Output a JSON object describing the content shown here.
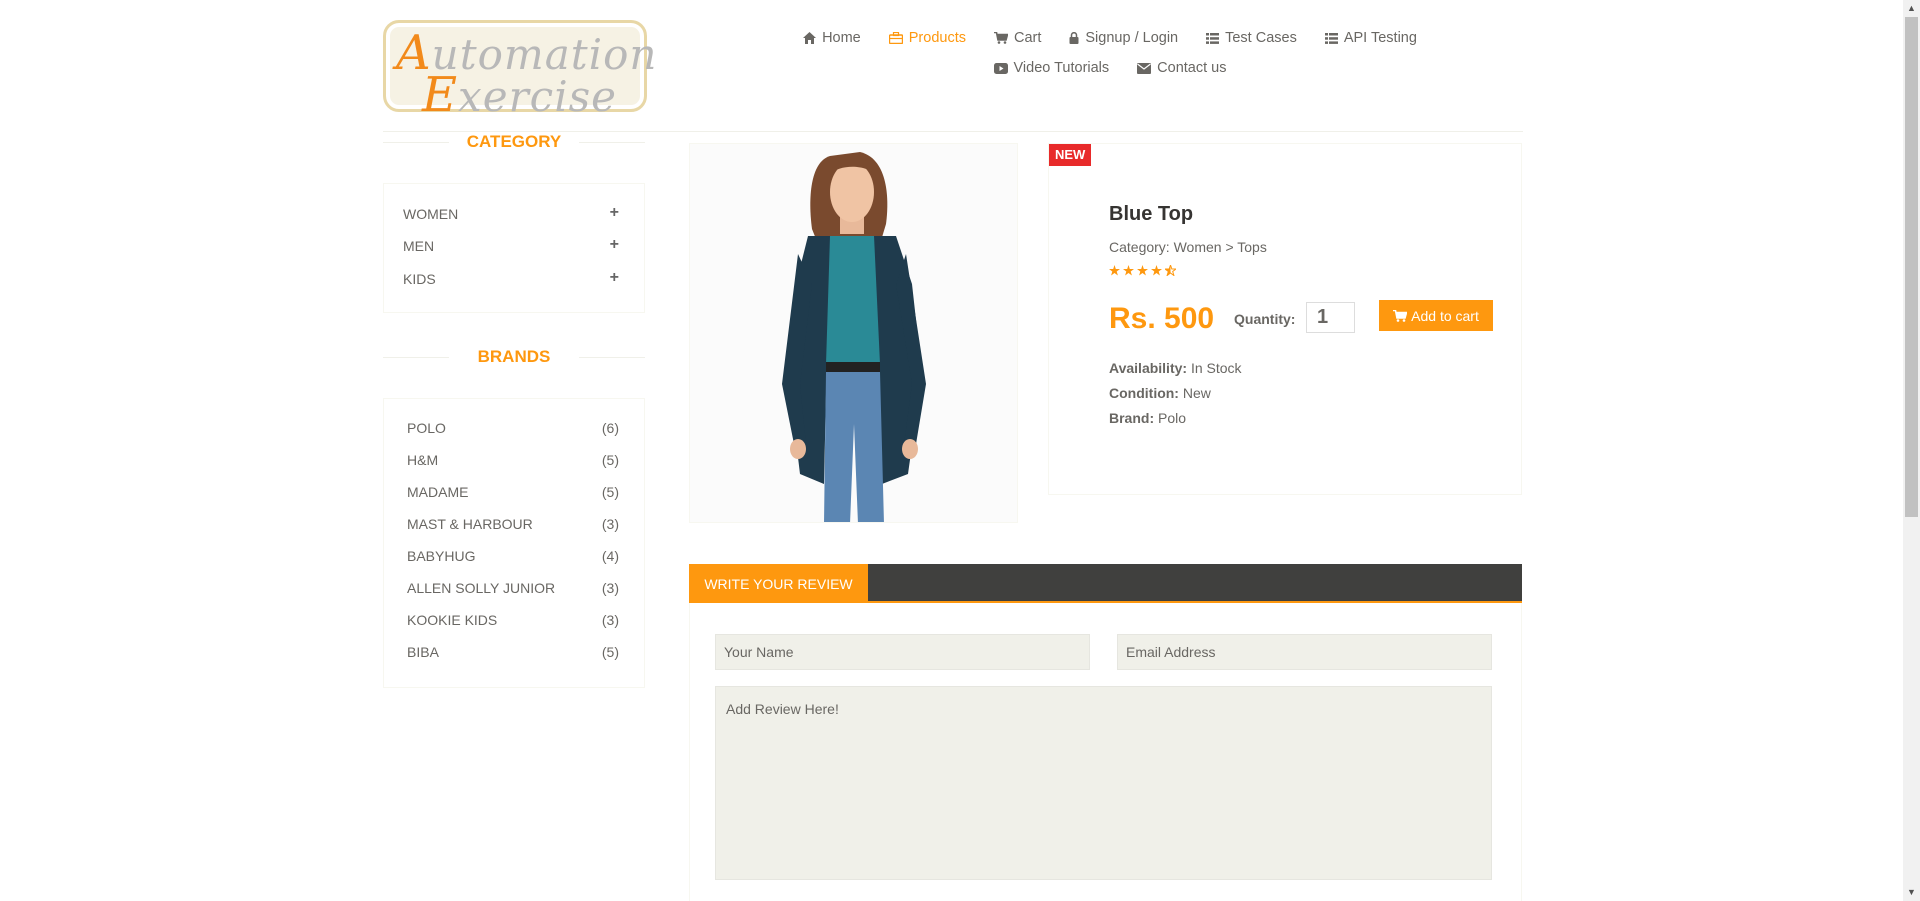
{
  "logo": {
    "line1_cap": "A",
    "line1_rest": "utomation",
    "line2_cap": "E",
    "line2_rest": "xercise"
  },
  "nav": {
    "items": [
      {
        "label": "Home",
        "icon": "home-icon"
      },
      {
        "label": "Products",
        "icon": "briefcase-icon",
        "active": true
      },
      {
        "label": "Cart",
        "icon": "cart-icon"
      },
      {
        "label": "Signup / Login",
        "icon": "lock-icon"
      },
      {
        "label": "Test Cases",
        "icon": "list-icon"
      },
      {
        "label": "API Testing",
        "icon": "list-icon"
      },
      {
        "label": "Video Tutorials",
        "icon": "youtube-play-icon"
      },
      {
        "label": "Contact us",
        "icon": "envelope-icon"
      }
    ]
  },
  "sidebar": {
    "category_title": "CATEGORY",
    "categories": [
      "WOMEN",
      "MEN",
      "KIDS"
    ],
    "brands_title": "BRANDS",
    "brands": [
      {
        "name": "POLO",
        "count": "(6)"
      },
      {
        "name": "H&M",
        "count": "(5)"
      },
      {
        "name": "MADAME",
        "count": "(5)"
      },
      {
        "name": "MAST & HARBOUR",
        "count": "(3)"
      },
      {
        "name": "BABYHUG",
        "count": "(4)"
      },
      {
        "name": "ALLEN SOLLY JUNIOR",
        "count": "(3)"
      },
      {
        "name": "KOOKIE KIDS",
        "count": "(3)"
      },
      {
        "name": "BIBA",
        "count": "(5)"
      }
    ]
  },
  "product": {
    "badge": "NEW",
    "name": "Blue Top",
    "category": "Category: Women > Tops",
    "rating": 4.5,
    "price": "Rs. 500",
    "quantity_label": "Quantity:",
    "quantity_value": "1",
    "add_to_cart": "Add to cart",
    "availability_label": "Availability:",
    "availability": "In Stock",
    "condition_label": "Condition:",
    "condition": "New",
    "brand_label": "Brand:",
    "brand": "Polo"
  },
  "review": {
    "tab_label": "WRITE YOUR REVIEW",
    "name_placeholder": "Your Name",
    "email_placeholder": "Email Address",
    "review_placeholder": "Add Review Here!"
  },
  "colors": {
    "accent": "#fe980f",
    "badge": "#e82a2a",
    "dark_bar": "#40403e",
    "input_bg": "#f0f0e9"
  }
}
